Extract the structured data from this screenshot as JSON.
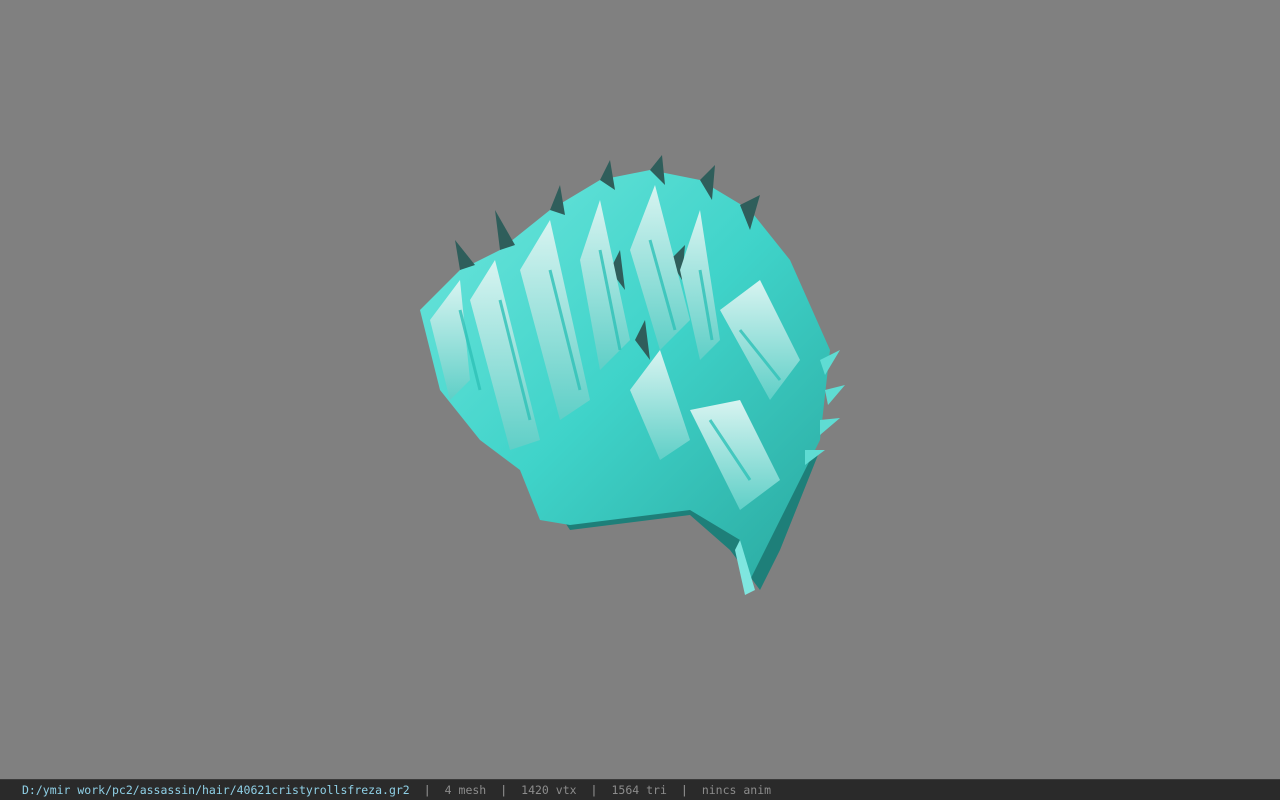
{
  "viewer": {
    "background_color": "#808080",
    "model_icon": "spiky-hair-model-icon",
    "model_colors": {
      "primary": "#3fd3c9",
      "highlight": "#c8f2ee",
      "shadow": "#1e7f79"
    }
  },
  "status": {
    "file_path": "D:/ymir work/pc2/assassin/hair/40621cristyrollsfreza.gr2",
    "separator": "|",
    "mesh": "4 mesh",
    "vertices": "1420 vtx",
    "triangles": "1564 tri",
    "animation": "nincs anim"
  }
}
